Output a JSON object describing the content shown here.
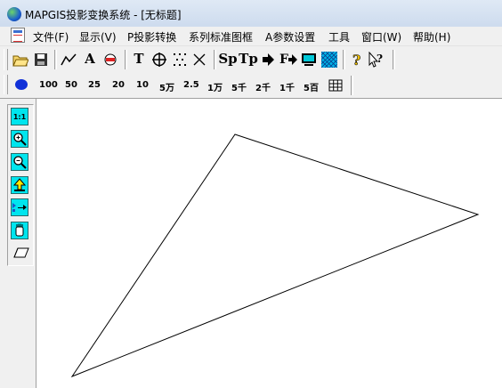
{
  "window": {
    "title": "MAPGIS投影变换系统 - [无标题]"
  },
  "menu": [
    {
      "label": "文件(F)"
    },
    {
      "label": "显示(V)"
    },
    {
      "label": "P投影转换"
    },
    {
      "label": "系列标准图框"
    },
    {
      "label": "A参数设置"
    },
    {
      "label": "工具"
    },
    {
      "label": "窗口(W)"
    },
    {
      "label": "帮助(H)"
    }
  ],
  "toolbar": {
    "text_tool_label": "A",
    "text_t_label": "T",
    "sp_label": "Sp",
    "tp_label": "Tp",
    "f_label": "F"
  },
  "scale_bar": {
    "items": [
      "100",
      "50",
      "25",
      "20",
      "10",
      "5万",
      "2.5",
      "1万",
      "5千",
      "2千",
      "1千",
      "5百"
    ]
  },
  "left_toolbar": {
    "one_to_one_label": "1:1"
  },
  "canvas": {
    "shape": "triangle",
    "stroke_color": "#000000"
  },
  "colors": {
    "titlebar": "#cddbee",
    "toolbar_bg": "#f0f0f0",
    "tool_cyan": "#00e5ee",
    "scale_dot": "#1030d8"
  }
}
